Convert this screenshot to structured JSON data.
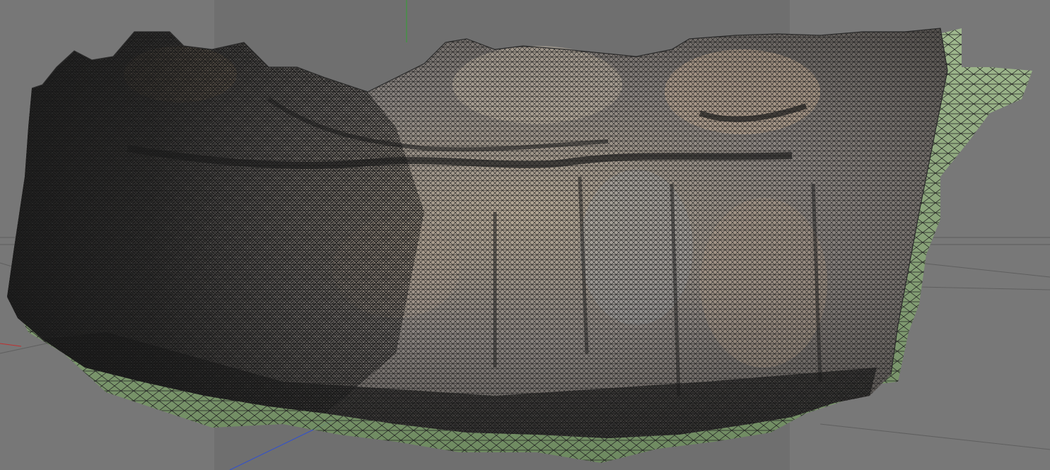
{
  "viewport": {
    "background": "#747474",
    "panel_colors": [
      "#777777",
      "#6f6f6f",
      "#787878"
    ],
    "mesh_colors": {
      "wire": "#1a1a1a",
      "rock_light": "#c9bca9",
      "rock_mid": "#8f8a85",
      "rock_dark": "#3a3836",
      "moss": "#8fb07a"
    },
    "axis_colors": {
      "x": "#c03030",
      "y": "#30a030",
      "z": "#3050d0"
    }
  }
}
